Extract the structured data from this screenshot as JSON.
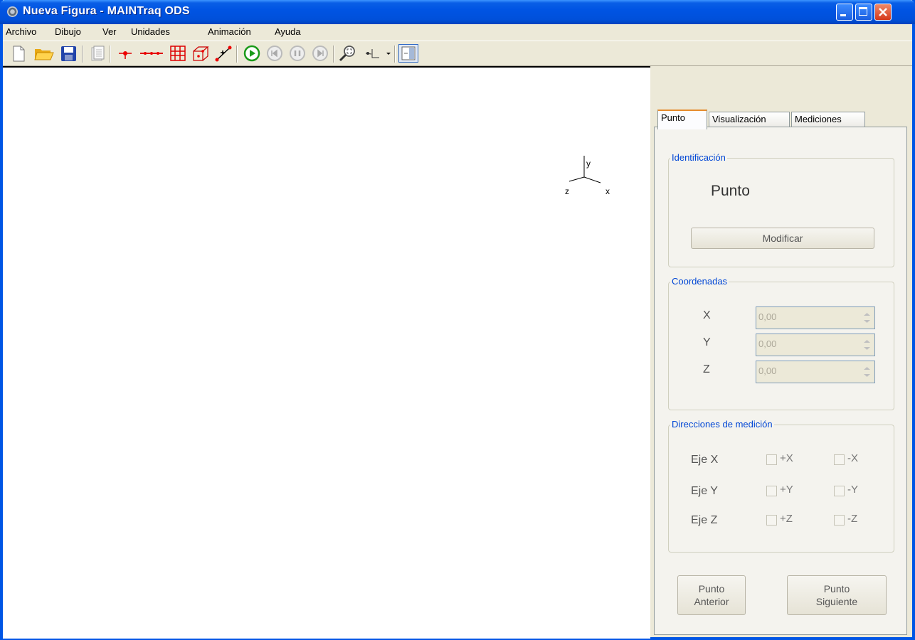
{
  "window": {
    "title": "Nueva Figura - MAINTraq ODS"
  },
  "menu": [
    {
      "label": "Archivo"
    },
    {
      "label": "Dibujo"
    },
    {
      "label": "Ver"
    },
    {
      "label": "Unidades"
    },
    {
      "label": "Animación"
    },
    {
      "label": "Ayuda"
    }
  ],
  "toolbar": [
    "new-file-icon",
    "open-folder-icon",
    "save-icon",
    "copy-icon",
    "add-point-icon",
    "add-line-icon",
    "add-grid-icon",
    "add-cube-icon",
    "connect-points-icon",
    "play-icon",
    "step-back-icon",
    "pause-icon",
    "step-forward-icon",
    "zoom-fit-icon",
    "view-axes-icon",
    "panel-toggle-icon"
  ],
  "axes": {
    "x": "x",
    "y": "y",
    "z": "z"
  },
  "panel": {
    "tabs": [
      {
        "label": "Punto"
      },
      {
        "label": "Visualización"
      },
      {
        "label": "Mediciones"
      }
    ],
    "identificacion": {
      "title": "Identificación",
      "name": "Punto",
      "modify": "Modificar"
    },
    "coordenadas": {
      "title": "Coordenadas",
      "rows": [
        {
          "label": "X",
          "value": "0,00"
        },
        {
          "label": "Y",
          "value": "0,00"
        },
        {
          "label": "Z",
          "value": "0,00"
        }
      ]
    },
    "direcciones": {
      "title": "Direcciones de medición",
      "rows": [
        {
          "label": "Eje X",
          "pos": "+X",
          "neg": "-X"
        },
        {
          "label": "Eje Y",
          "pos": "+Y",
          "neg": "-Y"
        },
        {
          "label": "Eje Z",
          "pos": "+Z",
          "neg": "-Z"
        }
      ]
    },
    "prev": {
      "line1": "Punto",
      "line2": "Anterior"
    },
    "next": {
      "line1": "Punto",
      "line2": "Siguiente"
    }
  }
}
